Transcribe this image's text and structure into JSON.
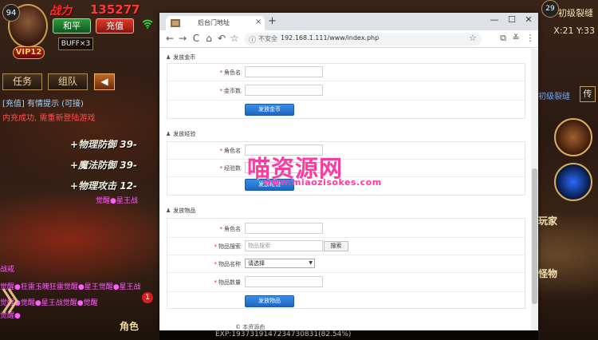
{
  "game": {
    "level": "94",
    "power_label": "战力",
    "power_value": "135277",
    "peace_button": "和平",
    "recharge_button": "充值",
    "buff_label": "BUFF×3",
    "vip_label": "VIP12",
    "task_tab": "任务",
    "team_tab": "组队",
    "collapse_arrow": "◀",
    "chat_line_1": "[充值] 有情提示 (可接)",
    "chat_line_2": "内充成功, 需重新登陆游戏",
    "attr_1": "+物理防御 39-",
    "attr_2": "+魔法防御 39-",
    "attr_3": "+物理攻击 12-",
    "chat_strip_1": "觉醒●星王战",
    "chat_strip_2": "觉醒●狂雷玉魄狂雷觉醒●星王觉醒●星王战",
    "chat_strip_3": "觉醒●觉醒●星王战觉醒●觉醒",
    "chat_strip_4": "觉醒●",
    "left_side_label": "战戒",
    "role_label": "角色",
    "notify_count": "1",
    "right_level": "29",
    "map_title": "初级裂缝",
    "coords": "X:21 Y:33",
    "map_name_small": "初级裂缝",
    "transfer_button": "传",
    "player_label": "玩家",
    "monster_label": "怪物",
    "exp_text": "EXP:1937319147234730831(82.54%)"
  },
  "browser": {
    "tab_title": "后台门地址",
    "tab_close": "×",
    "new_tab": "+",
    "minimize": "—",
    "maximize": "☐",
    "close": "✕",
    "nav_back": "←",
    "nav_forward": "→",
    "nav_reload": "C",
    "nav_home": "⌂",
    "nav_undo": "↶",
    "nav_star": "☆",
    "info_icon": "ⓘ",
    "insecure_label": "不安全",
    "url": "192.168.1.111/www/index.php",
    "omni_star": "☆",
    "crop_icon": "⧉",
    "ext_icon": "≚",
    "menu_icon": "⋮"
  },
  "form": {
    "user_icon": "♟",
    "gold": {
      "title": "发放金币",
      "role_label": "角色名",
      "amount_label": "金币数",
      "submit": "发放金币"
    },
    "exp": {
      "title": "发放经验",
      "role_label": "角色名",
      "amount_label": "经验数",
      "submit": "发放经验"
    },
    "item": {
      "title": "发放物品",
      "role_label": "角色名",
      "search_label": "物品搜索",
      "search_placeholder": "物品搜索",
      "search_button": "搜索",
      "name_label": "物品名称",
      "select_value": "请选择",
      "qty_label": "物品数量",
      "submit": "发放物品"
    },
    "required_mark": "*",
    "footer": "© 本资源由"
  },
  "watermark": {
    "main": "喵资源网",
    "sub": "www.miaozisokes.com"
  },
  "colors": {
    "accent_blue": "#1e66c4",
    "required_red": "#e02020",
    "watermark_pink": "#ff3aa0"
  }
}
